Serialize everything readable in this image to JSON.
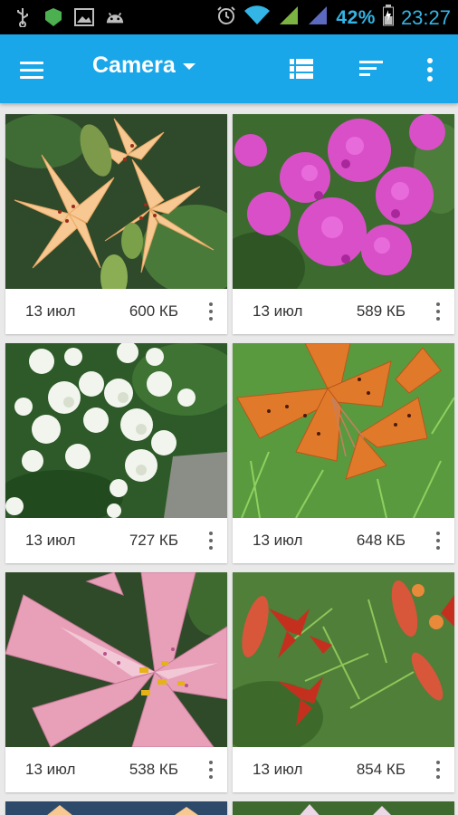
{
  "status_bar": {
    "battery": "42%",
    "time": "23:27",
    "icons": [
      "usb-icon",
      "shield-icon",
      "image-icon",
      "android-icon",
      "alarm-icon",
      "wifi-icon",
      "signal-icon",
      "signal-icon",
      "battery-icon"
    ]
  },
  "app_bar": {
    "title": "Camera",
    "icons": [
      "menu-icon",
      "dropdown-caret-icon",
      "list-view-icon",
      "sort-icon",
      "more-vert-icon"
    ]
  },
  "gallery": {
    "items": [
      {
        "date": "13 июл",
        "size": "600 КБ",
        "subject": "orange-lily"
      },
      {
        "date": "13 июл",
        "size": "589 КБ",
        "subject": "pink-phlox"
      },
      {
        "date": "13 июл",
        "size": "727 КБ",
        "subject": "white-hydrangea"
      },
      {
        "date": "13 июл",
        "size": "648 КБ",
        "subject": "tiger-lily"
      },
      {
        "date": "13 июл",
        "size": "538 КБ",
        "subject": "pink-lily"
      },
      {
        "date": "13 июл",
        "size": "854 КБ",
        "subject": "red-lilies"
      }
    ]
  },
  "colors": {
    "app_bar": "#1aa7ea",
    "status_text": "#33b5e5",
    "background": "#e9e9e9"
  }
}
